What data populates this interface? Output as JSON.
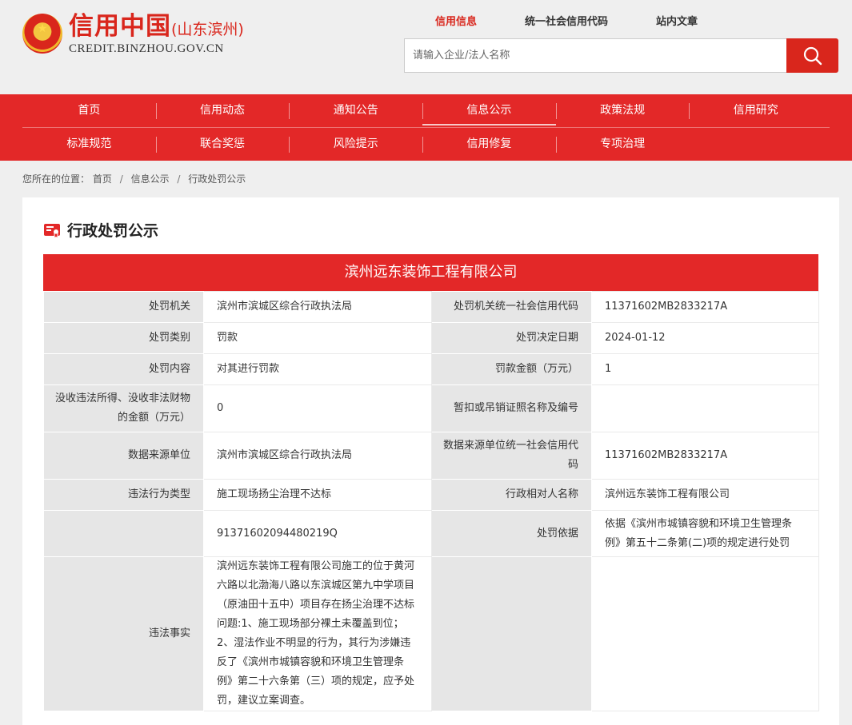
{
  "logo": {
    "title": "信用中国",
    "region": "(山东滨州)",
    "url": "CREDIT.BINZHOU.GOV.CN"
  },
  "search": {
    "tabs": [
      "信用信息",
      "统一社会信用代码",
      "站内文章"
    ],
    "active_tab": 0,
    "placeholder": "请输入企业/法人名称",
    "icon": "search-icon"
  },
  "nav": {
    "row1": [
      "首页",
      "信用动态",
      "通知公告",
      "信息公示",
      "政策法规",
      "信用研究"
    ],
    "row2": [
      "标准规范",
      "联合奖惩",
      "风险提示",
      "信用修复",
      "专项治理"
    ],
    "active": "信息公示"
  },
  "breadcrumb": {
    "prefix": "您所在的位置：",
    "items": [
      "首页",
      "信息公示",
      "行政处罚公示"
    ]
  },
  "panel": {
    "title": "行政处罚公示",
    "company": "滨州远东装饰工程有限公司"
  },
  "table": {
    "rows": [
      {
        "l1": "处罚机关",
        "v1": "滨州市滨城区综合行政执法局",
        "l2": "处罚机关统一社会信用代码",
        "v2": "11371602MB2833217A"
      },
      {
        "l1": "处罚类别",
        "v1": "罚款",
        "l2": "处罚决定日期",
        "v2": "2024-01-12"
      },
      {
        "l1": "处罚内容",
        "v1": "对其进行罚款",
        "l2": "罚款金额（万元）",
        "v2": "1"
      },
      {
        "l1": "没收违法所得、没收非法财物的金额（万元）",
        "v1": "0",
        "l2": "暂扣或吊销证照名称及编号",
        "v2": ""
      },
      {
        "l1": "数据来源单位",
        "v1": "滨州市滨城区综合行政执法局",
        "l2": "数据来源单位统一社会信用代码",
        "v2": "11371602MB2833217A"
      },
      {
        "l1": "违法行为类型",
        "v1": "施工现场扬尘治理不达标",
        "l2": "行政相对人名称",
        "v2": "滨州远东装饰工程有限公司"
      },
      {
        "l1": "",
        "v1": "91371602094480219Q",
        "l2": "处罚依据",
        "v2": "依据《滨州市城镇容貌和环境卫生管理条例》第五十二条第(二)项的规定进行处罚"
      },
      {
        "l1": "违法事实",
        "v1": "滨州远东装饰工程有限公司施工的位于黄河六路以北渤海八路以东滨城区第九中学项目（原油田十五中）项目存在扬尘治理不达标问题:1、施工现场部分裸土未覆盖到位；2、湿法作业不明显的行为，其行为涉嫌违反了《滨州市城镇容貌和环境卫生管理条例》第二十六条第（三）项的规定，应予处罚，建议立案调查。",
        "l2": "",
        "v2": ""
      }
    ]
  },
  "colors": {
    "brand_red": "#e32828",
    "label_bg": "#e6e6e6",
    "page_bg": "#efefef"
  }
}
